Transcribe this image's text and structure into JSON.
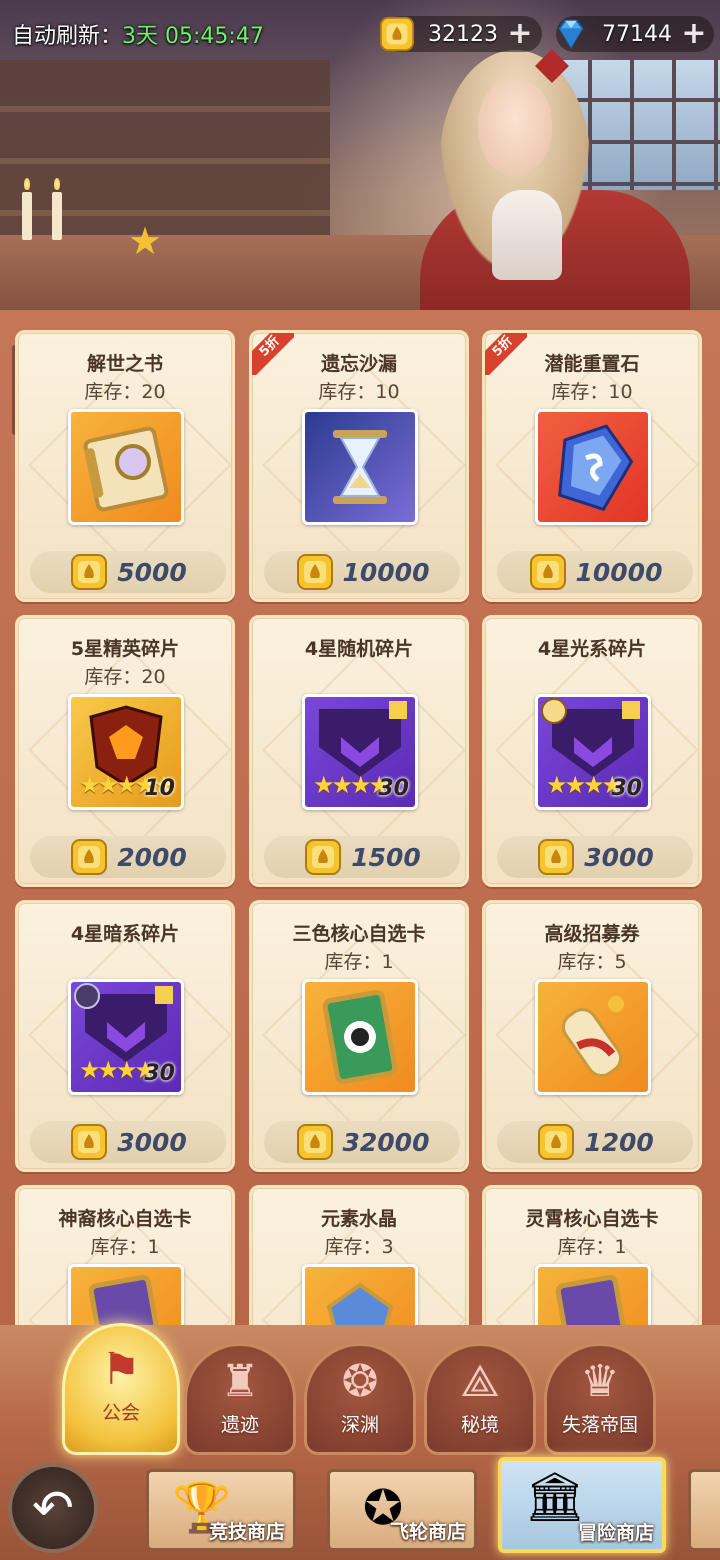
{
  "hud": {
    "refresh_label": "自动刷新：",
    "refresh_time": "3天 05:45:47",
    "gold_value": "32123",
    "diamond_value": "77144",
    "plus": "+"
  },
  "items": [
    {
      "name": "解世之书",
      "stock": "库存：20",
      "price": "5000",
      "discount": ""
    },
    {
      "name": "遗忘沙漏",
      "stock": "库存：10",
      "price": "10000",
      "discount": "5折"
    },
    {
      "name": "潜能重置石",
      "stock": "库存：10",
      "price": "10000",
      "discount": "5折"
    },
    {
      "name": "5星精英碎片",
      "stock": "库存：20",
      "price": "2000",
      "fragment_count": "10"
    },
    {
      "name": "4星随机碎片",
      "stock": "",
      "price": "1500",
      "fragment_count": "30"
    },
    {
      "name": "4星光系碎片",
      "stock": "",
      "price": "3000",
      "fragment_count": "30"
    },
    {
      "name": "4星暗系碎片",
      "stock": "",
      "price": "3000",
      "fragment_count": "30"
    },
    {
      "name": "三色核心自选卡",
      "stock": "库存：1",
      "price": "32000"
    },
    {
      "name": "高级招募券",
      "stock": "库存：5",
      "price": "1200"
    },
    {
      "name": "神裔核心自选卡",
      "stock": "库存：1"
    },
    {
      "name": "元素水晶",
      "stock": "库存：3"
    },
    {
      "name": "灵霄核心自选卡",
      "stock": "库存：1"
    }
  ],
  "categories": [
    "公会",
    "遗迹",
    "深渊",
    "秘境",
    "失落帝国"
  ],
  "shop_tabs": [
    "竞技商店",
    "飞轮商店",
    "冒险商店"
  ],
  "colors": {
    "gold": "#f2b62c",
    "diamond": "#3ea0f0",
    "accent": "#6df26a",
    "discount": "#d7412d"
  }
}
